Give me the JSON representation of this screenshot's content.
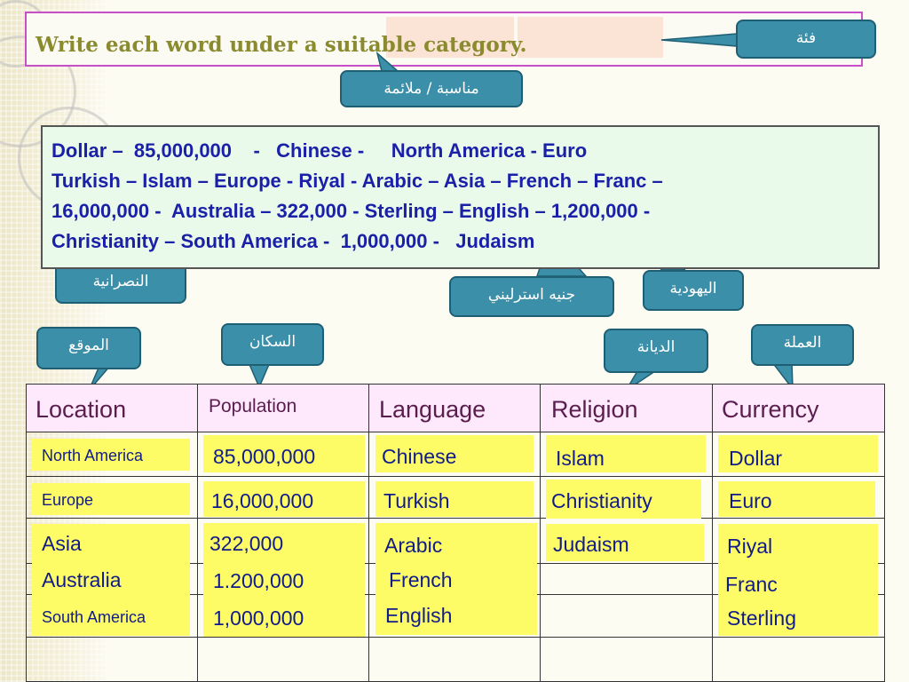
{
  "title": "Write each word under a suitable category.",
  "callouts": {
    "category": "فئة",
    "suitable": "مناسبة / ملائمة",
    "christianity": "النصرانية",
    "sterling": "جنيه استرليني",
    "judaism": "اليهودية",
    "location": "الموقع",
    "population": "السكان",
    "religion": "الديانة",
    "currency": "العملة"
  },
  "word_bank": [
    "Dollar –  85,000,000    -   Chinese -     North America - Euro",
    "Turkish – Islam – Europe - Riyal - Arabic – Asia – French – Franc –",
    "16,000,000 -  Australia – 322,000 - Sterling – English – 1,200,000 -",
    "Christianity – South America -  1,000,000 -   Judaism"
  ],
  "table": {
    "headers": [
      "Location",
      "Population",
      "Language",
      "Religion",
      "Currency"
    ],
    "location": [
      "North America",
      "Europe",
      "Asia",
      "Australia",
      "South America"
    ],
    "population": [
      "85,000,000",
      "16,000,000",
      "322,000",
      "1.200,000",
      "1,000,000"
    ],
    "language": [
      "Chinese",
      "Turkish",
      "Arabic",
      "French",
      "English"
    ],
    "religion": [
      "Islam",
      "Christianity",
      "Judaism"
    ],
    "currency": [
      "Dollar",
      "Euro",
      "Riyal",
      "Franc",
      "Sterling"
    ]
  },
  "colors": {
    "callout_bg": "#3c8fa8",
    "word_text": "#1a21a8",
    "header_bg": "#fde9fb",
    "answer_bg": "#fdfc66",
    "title_border": "#c94fc9"
  }
}
